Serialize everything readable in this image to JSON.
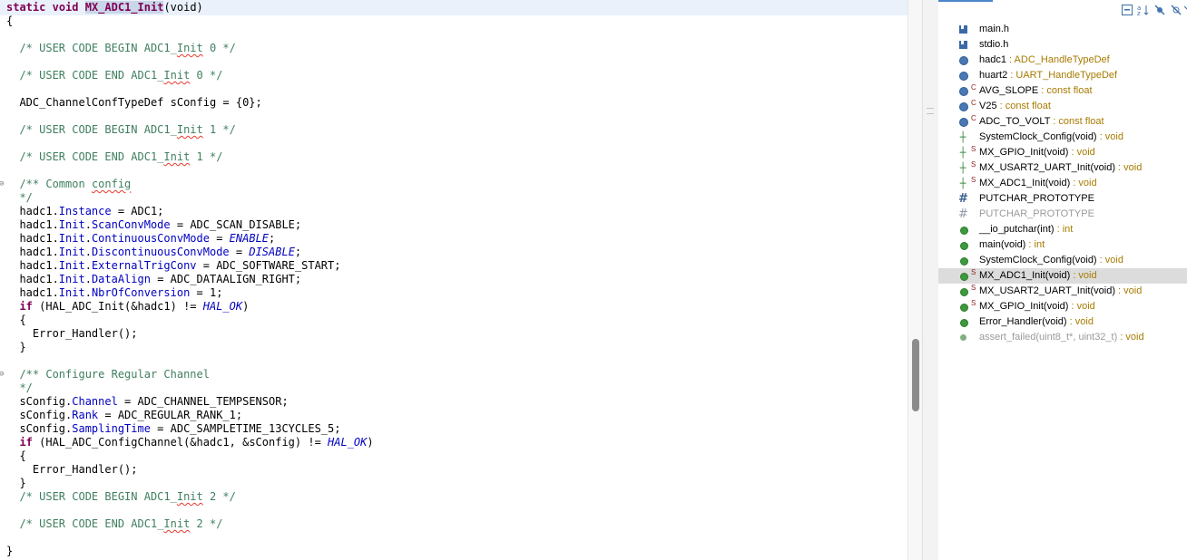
{
  "editor": {
    "lines": [
      {
        "spans": [
          {
            "t": "static",
            "c": "kw"
          },
          {
            "t": " "
          },
          {
            "t": "void",
            "c": "kw"
          },
          {
            "t": " "
          },
          {
            "t": "MX_ADC1_Init",
            "c": "hl kw"
          },
          {
            "t": "(void)"
          }
        ]
      },
      {
        "spans": [
          {
            "t": "{"
          }
        ]
      },
      {
        "spans": []
      },
      {
        "spans": [
          {
            "t": "  "
          },
          {
            "t": "/* USER CODE BEGIN ADC1_",
            "c": "cm"
          },
          {
            "t": "Init",
            "c": "cm spell"
          },
          {
            "t": " 0 */",
            "c": "cm"
          }
        ]
      },
      {
        "spans": []
      },
      {
        "spans": [
          {
            "t": "  "
          },
          {
            "t": "/* USER CODE END ADC1_",
            "c": "cm"
          },
          {
            "t": "Init",
            "c": "cm spell"
          },
          {
            "t": " 0 */",
            "c": "cm"
          }
        ]
      },
      {
        "spans": []
      },
      {
        "spans": [
          {
            "t": "  ADC_ChannelConfTypeDef sConfig = {0};"
          }
        ]
      },
      {
        "spans": []
      },
      {
        "spans": [
          {
            "t": "  "
          },
          {
            "t": "/* USER CODE BEGIN ADC1_",
            "c": "cm"
          },
          {
            "t": "Init",
            "c": "cm spell"
          },
          {
            "t": " 1 */",
            "c": "cm"
          }
        ]
      },
      {
        "spans": []
      },
      {
        "spans": [
          {
            "t": "  "
          },
          {
            "t": "/* USER CODE END ADC1_",
            "c": "cm"
          },
          {
            "t": "Init",
            "c": "cm spell"
          },
          {
            "t": " 1 */",
            "c": "cm"
          }
        ]
      },
      {
        "spans": []
      },
      {
        "fold": true,
        "spans": [
          {
            "t": "  "
          },
          {
            "t": "/** Common ",
            "c": "cm"
          },
          {
            "t": "config",
            "c": "cm spell"
          }
        ]
      },
      {
        "spans": [
          {
            "t": "  "
          },
          {
            "t": "*/",
            "c": "cm"
          }
        ]
      },
      {
        "spans": [
          {
            "t": "  hadc1."
          },
          {
            "t": "Instance",
            "c": "fld"
          },
          {
            "t": " = ADC1;"
          }
        ]
      },
      {
        "spans": [
          {
            "t": "  hadc1."
          },
          {
            "t": "Init",
            "c": "fld"
          },
          {
            "t": "."
          },
          {
            "t": "ScanConvMode",
            "c": "fld"
          },
          {
            "t": " = ADC_SCAN_DISABLE;"
          }
        ]
      },
      {
        "spans": [
          {
            "t": "  hadc1."
          },
          {
            "t": "Init",
            "c": "fld"
          },
          {
            "t": "."
          },
          {
            "t": "ContinuousConvMode",
            "c": "fld"
          },
          {
            "t": " = "
          },
          {
            "t": "ENABLE",
            "c": "enum"
          },
          {
            "t": ";"
          }
        ]
      },
      {
        "spans": [
          {
            "t": "  hadc1."
          },
          {
            "t": "Init",
            "c": "fld"
          },
          {
            "t": "."
          },
          {
            "t": "DiscontinuousConvMode",
            "c": "fld"
          },
          {
            "t": " = "
          },
          {
            "t": "DISABLE",
            "c": "enum"
          },
          {
            "t": ";"
          }
        ]
      },
      {
        "spans": [
          {
            "t": "  hadc1."
          },
          {
            "t": "Init",
            "c": "fld"
          },
          {
            "t": "."
          },
          {
            "t": "ExternalTrigConv",
            "c": "fld"
          },
          {
            "t": " = ADC_SOFTWARE_START;"
          }
        ]
      },
      {
        "spans": [
          {
            "t": "  hadc1."
          },
          {
            "t": "Init",
            "c": "fld"
          },
          {
            "t": "."
          },
          {
            "t": "DataAlign",
            "c": "fld"
          },
          {
            "t": " = ADC_DATAALIGN_RIGHT;"
          }
        ]
      },
      {
        "spans": [
          {
            "t": "  hadc1."
          },
          {
            "t": "Init",
            "c": "fld"
          },
          {
            "t": "."
          },
          {
            "t": "NbrOfConversion",
            "c": "fld"
          },
          {
            "t": " = 1;"
          }
        ]
      },
      {
        "spans": [
          {
            "t": "  "
          },
          {
            "t": "if",
            "c": "kw"
          },
          {
            "t": " (HAL_ADC_Init(&hadc1) != "
          },
          {
            "t": "HAL_OK",
            "c": "enum"
          },
          {
            "t": ")"
          }
        ]
      },
      {
        "spans": [
          {
            "t": "  {"
          }
        ]
      },
      {
        "spans": [
          {
            "t": "    Error_Handler();"
          }
        ]
      },
      {
        "spans": [
          {
            "t": "  }"
          }
        ]
      },
      {
        "spans": []
      },
      {
        "fold": true,
        "spans": [
          {
            "t": "  "
          },
          {
            "t": "/** Configure Regular Channel",
            "c": "cm"
          }
        ]
      },
      {
        "spans": [
          {
            "t": "  "
          },
          {
            "t": "*/",
            "c": "cm"
          }
        ]
      },
      {
        "spans": [
          {
            "t": "  sConfig."
          },
          {
            "t": "Channel",
            "c": "fld"
          },
          {
            "t": " = ADC_CHANNEL_TEMPSENSOR;"
          }
        ]
      },
      {
        "spans": [
          {
            "t": "  sConfig."
          },
          {
            "t": "Rank",
            "c": "fld"
          },
          {
            "t": " = ADC_REGULAR_RANK_1;"
          }
        ]
      },
      {
        "spans": [
          {
            "t": "  sConfig."
          },
          {
            "t": "SamplingTime",
            "c": "fld"
          },
          {
            "t": " = ADC_SAMPLETIME_13CYCLES_5;"
          }
        ]
      },
      {
        "spans": [
          {
            "t": "  "
          },
          {
            "t": "if",
            "c": "kw"
          },
          {
            "t": " (HAL_ADC_ConfigChannel(&hadc1, &sConfig) != "
          },
          {
            "t": "HAL_OK",
            "c": "enum"
          },
          {
            "t": ")"
          }
        ]
      },
      {
        "spans": [
          {
            "t": "  {"
          }
        ]
      },
      {
        "spans": [
          {
            "t": "    Error_Handler();"
          }
        ]
      },
      {
        "spans": [
          {
            "t": "  }"
          }
        ]
      },
      {
        "spans": [
          {
            "t": "  "
          },
          {
            "t": "/* USER CODE BEGIN ADC1_",
            "c": "cm"
          },
          {
            "t": "Init",
            "c": "cm spell"
          },
          {
            "t": " 2 */",
            "c": "cm"
          }
        ]
      },
      {
        "spans": []
      },
      {
        "spans": [
          {
            "t": "  "
          },
          {
            "t": "/* USER CODE END ADC1_",
            "c": "cm"
          },
          {
            "t": "Init",
            "c": "cm spell"
          },
          {
            "t": " 2 */",
            "c": "cm"
          }
        ]
      },
      {
        "spans": []
      },
      {
        "spans": [
          {
            "t": "}"
          }
        ]
      }
    ]
  },
  "outline": {
    "toolbar_icons": [
      "collapse-all-icon",
      "sort-icon",
      "hide-fields-icon",
      "hide-static-icon",
      "more-icon"
    ],
    "items": [
      {
        "icon": "header-icon",
        "kind": "hdr",
        "label": "main.h",
        "type": ""
      },
      {
        "icon": "header-icon",
        "kind": "hdr",
        "label": "stdio.h",
        "type": ""
      },
      {
        "icon": "variable-icon",
        "kind": "dot-blue",
        "label": "hadc1",
        "type": " : ADC_HandleTypeDef"
      },
      {
        "icon": "variable-icon",
        "kind": "dot-blue",
        "label": "huart2",
        "type": " : UART_HandleTypeDef"
      },
      {
        "icon": "const-variable-icon",
        "kind": "dot-blue",
        "sup": "C",
        "label": "AVG_SLOPE",
        "type": " : const float"
      },
      {
        "icon": "const-variable-icon",
        "kind": "dot-blue",
        "sup": "C",
        "label": "V25",
        "type": " : const float"
      },
      {
        "icon": "const-variable-icon",
        "kind": "dot-blue",
        "sup": "C",
        "label": "ADC_TO_VOLT",
        "type": " : const float"
      },
      {
        "icon": "function-prototype-icon",
        "kind": "fnproto",
        "label": "SystemClock_Config(void)",
        "type": " : void"
      },
      {
        "icon": "function-prototype-icon",
        "kind": "fnproto",
        "sup": "S",
        "label": "MX_GPIO_Init(void)",
        "type": " : void"
      },
      {
        "icon": "function-prototype-icon",
        "kind": "fnproto",
        "sup": "S",
        "label": "MX_USART2_UART_Init(void)",
        "type": " : void"
      },
      {
        "icon": "function-prototype-icon",
        "kind": "fnproto",
        "sup": "S",
        "label": "MX_ADC1_Init(void)",
        "type": " : void"
      },
      {
        "icon": "macro-icon",
        "kind": "macro",
        "label": "PUTCHAR_PROTOTYPE",
        "type": ""
      },
      {
        "icon": "inactive-macro-icon",
        "kind": "macro off",
        "label": "PUTCHAR_PROTOTYPE",
        "type": "",
        "disabled": true
      },
      {
        "icon": "function-icon",
        "kind": "dot-green",
        "label": "__io_putchar(int)",
        "type": " : int"
      },
      {
        "icon": "function-icon",
        "kind": "dot-green",
        "label": "main(void)",
        "type": " : int"
      },
      {
        "icon": "function-icon",
        "kind": "dot-green",
        "label": "SystemClock_Config(void)",
        "type": " : void"
      },
      {
        "icon": "function-icon",
        "kind": "dot-green",
        "sup": "S",
        "label": "MX_ADC1_Init(void)",
        "type": " : void",
        "selected": true
      },
      {
        "icon": "function-icon",
        "kind": "dot-green",
        "sup": "S",
        "label": "MX_USART2_UART_Init(void)",
        "type": " : void"
      },
      {
        "icon": "function-icon",
        "kind": "dot-green",
        "sup": "S",
        "label": "MX_GPIO_Init(void)",
        "type": " : void"
      },
      {
        "icon": "function-icon",
        "kind": "dot-green",
        "label": "Error_Handler(void)",
        "type": " : void"
      },
      {
        "icon": "inactive-function-icon",
        "kind": "dot-strike",
        "label": "assert_failed(uint8_t*, uint32_t)",
        "type": " : void",
        "disabled": true
      }
    ]
  }
}
